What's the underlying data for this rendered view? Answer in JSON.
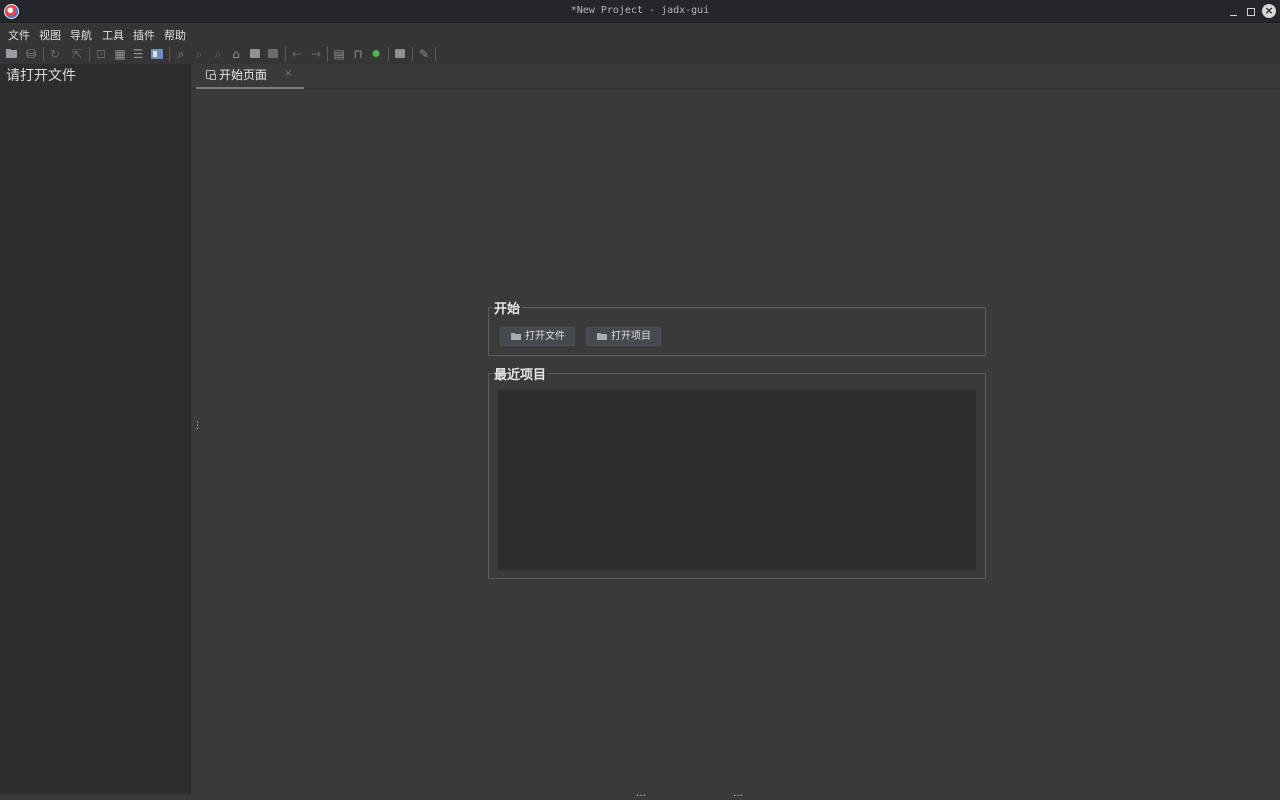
{
  "window": {
    "title": "*New Project - jadx-gui"
  },
  "menu": {
    "items": [
      "文件",
      "视图",
      "导航",
      "工具",
      "插件",
      "帮助"
    ]
  },
  "toolbar": {
    "icons": [
      "open-file-icon",
      "save-all-icon",
      "reload-icon",
      "export-icon",
      "decompile-icon",
      "sync-tree-icon",
      "flatten-packages-icon",
      "show-code-icon",
      "search-icon",
      "class-search-icon",
      "comment-search-icon",
      "home-icon",
      "back-square-icon",
      "forward-square-icon",
      "back-arrow-icon",
      "forward-arrow-icon",
      "log-viewer-icon",
      "bookmark-icon",
      "debug-icon",
      "quark-icon",
      "preferences-icon"
    ]
  },
  "left_panel": {
    "hint": "请打开文件"
  },
  "tabs": [
    {
      "label": "开始页面",
      "close": "×"
    }
  ],
  "start_page": {
    "start_group_title": "开始",
    "open_file_button": "打开文件",
    "open_project_button": "打开项目",
    "recent_group_title": "最近项目",
    "recent_items": []
  },
  "splitter": {
    "vertical_handle": "⋮",
    "bottom_handle": "…"
  }
}
